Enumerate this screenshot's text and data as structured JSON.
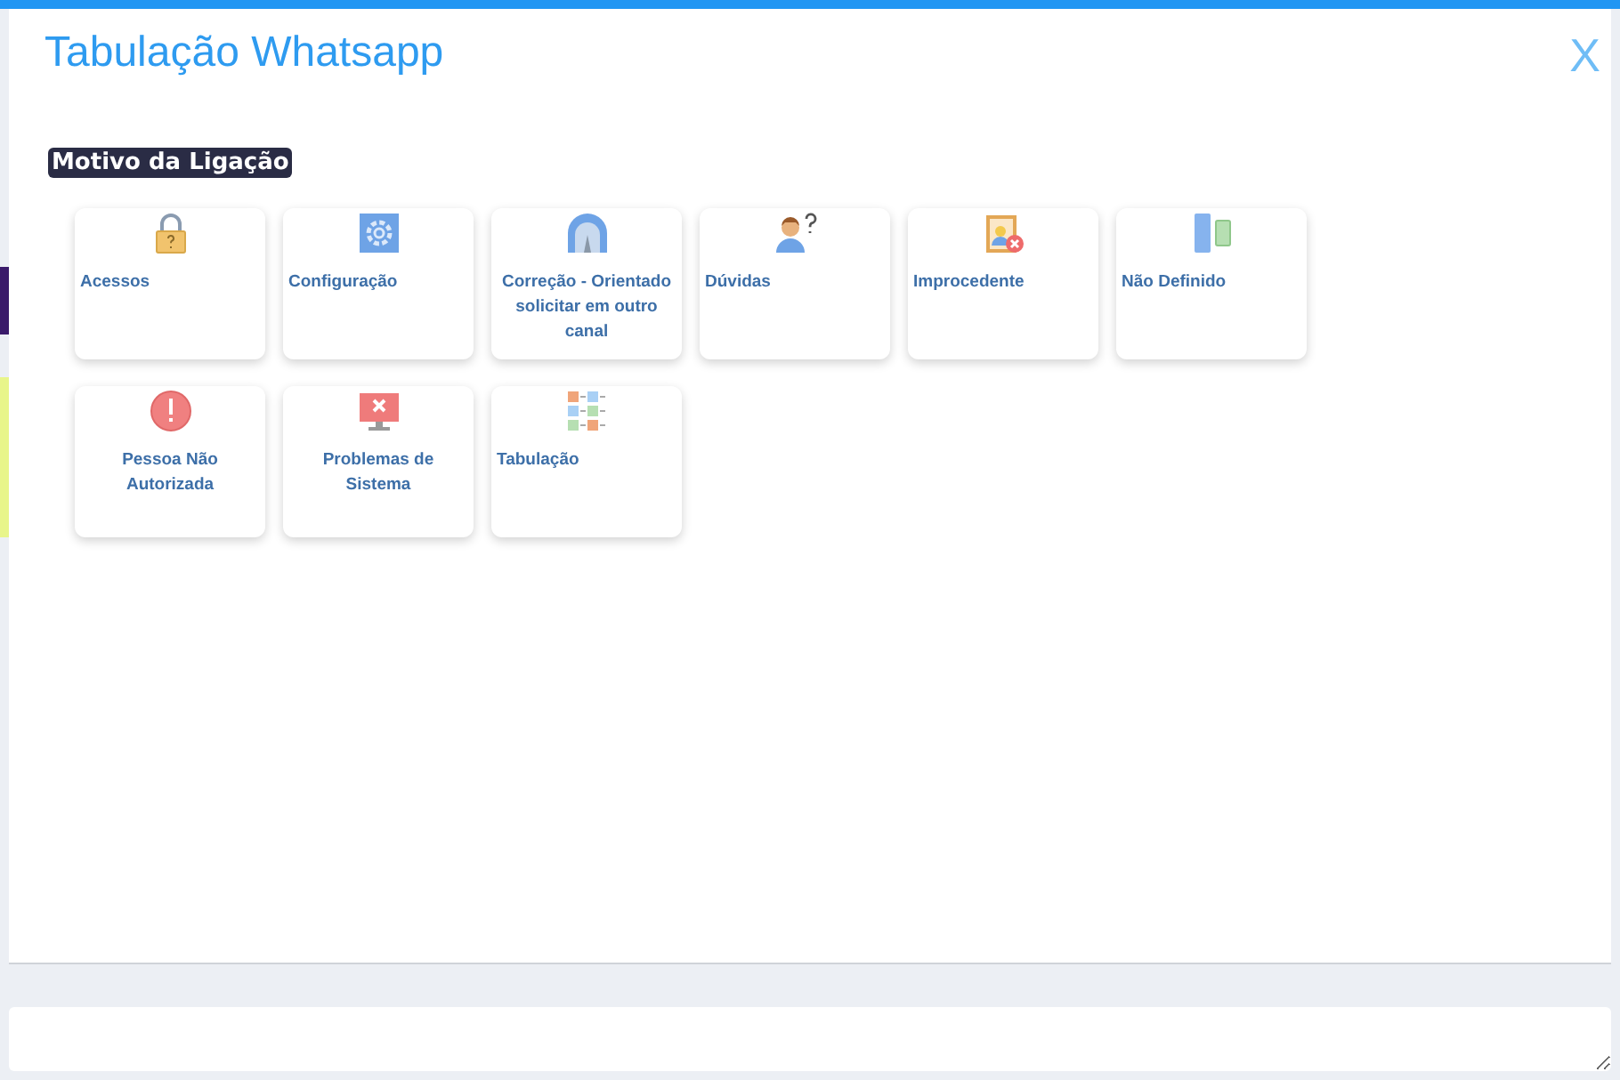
{
  "dialog": {
    "title": "Tabulação Whatsapp",
    "close": "X"
  },
  "section": {
    "heading": "Motivo da Ligação"
  },
  "options": [
    {
      "label": "Acessos",
      "kind": "lock",
      "centered": false
    },
    {
      "label": "Configuração",
      "kind": "gear",
      "centered": false
    },
    {
      "label": "Correção - Orientado solicitar em outro canal",
      "kind": "tunnel",
      "centered": true
    },
    {
      "label": "Dúvidas",
      "kind": "person-question",
      "centered": false
    },
    {
      "label": "Improcedente",
      "kind": "badge-x",
      "centered": false
    },
    {
      "label": "Não Definido",
      "kind": "panels",
      "centered": false
    },
    {
      "label": "Pessoa Não Autorizada",
      "kind": "alert",
      "centered": true
    },
    {
      "label": "Problemas de Sistema",
      "kind": "monitor-x",
      "centered": true
    },
    {
      "label": "Tabulação",
      "kind": "grid",
      "centered": false
    }
  ]
}
